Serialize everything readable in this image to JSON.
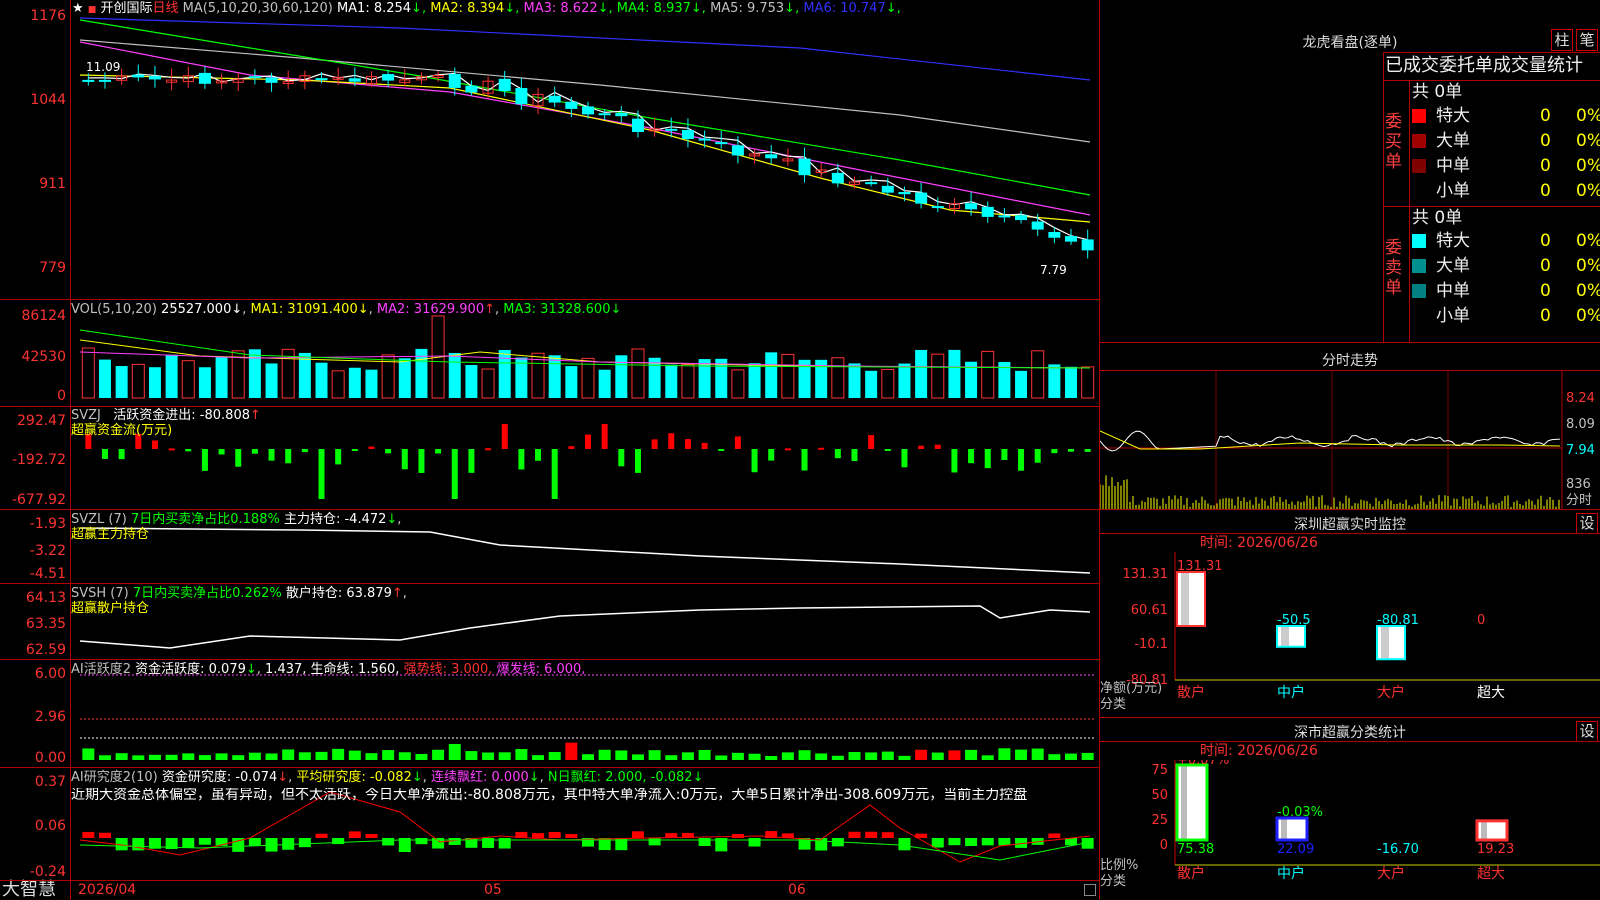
{
  "main": {
    "title": "开创国际",
    "period": "日线",
    "ma_label": "MA(5,10,20,30,60,120)",
    "ma_values": [
      {
        "label": "MA1: 8.254",
        "arrow": "↓",
        "color": "#ffffff"
      },
      {
        "label": "MA2: 8.394",
        "arrow": "↓",
        "color": "#ffff00"
      },
      {
        "label": "MA3: 8.622",
        "arrow": "↓",
        "color": "#ff40ff"
      },
      {
        "label": "MA4: 8.937",
        "arrow": "↓",
        "color": "#00ff00"
      },
      {
        "label": "MA5: 9.753",
        "arrow": "↓",
        "color": "#c0c0c0"
      },
      {
        "label": "MA6: 10.747",
        "arrow": "↓",
        "color": "#3030ff"
      }
    ],
    "y_ticks": [
      "1176",
      "1044",
      "911",
      "779"
    ],
    "high_label": "11.09",
    "low_label": "7.79"
  },
  "vol": {
    "label": "VOL(5,10,20)",
    "value": "25527.000",
    "ma1": "MA1: 31091.400",
    "ma2": "MA2: 31629.900",
    "ma3": "MA3: 31328.600",
    "y_ticks": [
      "86124",
      "42530",
      "0"
    ]
  },
  "svzj": {
    "label": "SVZJ",
    "text1": "活跃资金进出: -80.808",
    "text2": "超赢资金流(万元)",
    "y_ticks": [
      "292.47",
      "-192.72",
      "-677.92"
    ]
  },
  "svzl": {
    "label": "SVZL (7)",
    "text1": "7日内买卖净占比0.188%",
    "text2": "主力持仓: -4.472",
    "text3": "超赢主力持仓",
    "y_ticks": [
      "-1.93",
      "-3.22",
      "-4.51"
    ]
  },
  "svsh": {
    "label": "SVSH (7)",
    "text1": "7日内买卖净占比0.262%",
    "text2": "散户持仓: 63.879",
    "text3": "超赢散户持仓",
    "y_ticks": [
      "64.13",
      "63.35",
      "62.59"
    ]
  },
  "ai1": {
    "label": "AI活跃度2",
    "text1": "资金活跃度: 0.079",
    "text2": "1.437,",
    "text3": "生命线: 1.560,",
    "text4": "强势线: 3.000,",
    "text5": "爆发线: 6.000,",
    "y_ticks": [
      "6.00",
      "2.96",
      "0.00"
    ]
  },
  "ai2": {
    "label": "AI研究度2(10)",
    "text1": "资金研究度: -0.074",
    "text2": "平均研究度: -0.082",
    "text3": "连续飘红: 0.000",
    "text4": "N日飘红: 2.000, -0.082",
    "comment": "近期大资金总体偏空，虽有异动，但不太活跃，今日大单净流出:-80.808万元，其中特大单净流入:0万元，大单5日累计净出-308.609万元，当前主力控盘",
    "y_ticks": [
      "0.37",
      "0.06",
      "-0.24"
    ]
  },
  "xaxis": {
    "labels": [
      "2026/04",
      "05",
      "06"
    ],
    "brand": "大智慧"
  },
  "dragon": {
    "title": "龙虎看盘(逐单)",
    "btn1": "柱",
    "btn2": "笔",
    "header": "已成交委托单成交量统计",
    "buy": {
      "side": "委买单",
      "total": "共 0单",
      "rows": [
        {
          "name": "特大",
          "val": "0",
          "pct": "0%",
          "color": "#ff0000"
        },
        {
          "name": "大单",
          "val": "0",
          "pct": "0%",
          "color": "#a00000"
        },
        {
          "name": "中单",
          "val": "0",
          "pct": "0%",
          "color": "#800000"
        },
        {
          "name": "小单",
          "val": "0",
          "pct": "0%",
          "color": ""
        }
      ]
    },
    "sell": {
      "side": "委卖单",
      "total": "共 0单",
      "rows": [
        {
          "name": "特大",
          "val": "0",
          "pct": "0%",
          "color": "#00ffff"
        },
        {
          "name": "大单",
          "val": "0",
          "pct": "0%",
          "color": "#009090"
        },
        {
          "name": "中单",
          "val": "0",
          "pct": "0%",
          "color": "#008080"
        },
        {
          "name": "小单",
          "val": "0",
          "pct": "0%",
          "color": ""
        }
      ]
    }
  },
  "intraday": {
    "title": "分时走势",
    "y_ticks": [
      "8.24",
      "8.09",
      "7.94",
      "836",
      "分时"
    ]
  },
  "monitor": {
    "title": "深圳超赢实时监控",
    "set_btn": "设",
    "time": "时间: 2026/06/26",
    "y_ticks": [
      "131.31",
      "60.61",
      "-10.1",
      "-80.81"
    ],
    "ylabel1": "净额(万元)",
    "ylabel2": "分类",
    "bars": [
      {
        "cat": "散户",
        "value": 131.31,
        "label": "131.31"
      },
      {
        "cat": "中户",
        "value": -50.5,
        "label": "-50.5"
      },
      {
        "cat": "大户",
        "value": -80.81,
        "label": "-80.81"
      },
      {
        "cat": "超大",
        "value": 0,
        "label": "0"
      }
    ]
  },
  "classify": {
    "title": "深市超赢分类统计",
    "set_btn": "设",
    "time": "时间: 2026/06/26",
    "y_ticks": [
      "75",
      "50",
      "25",
      "0"
    ],
    "ylabel1": "比例%",
    "ylabel2": "分类",
    "top_labels": [
      "+0.07%",
      "-0.03%"
    ],
    "bars": [
      {
        "cat": "散户",
        "value": 75.38,
        "label": "75.38"
      },
      {
        "cat": "中户",
        "value": 22.09,
        "label": "22.09"
      },
      {
        "cat": "大户",
        "value": -16.7,
        "label": "-16.70"
      },
      {
        "cat": "超大",
        "value": 19.23,
        "label": "19.23"
      }
    ]
  }
}
